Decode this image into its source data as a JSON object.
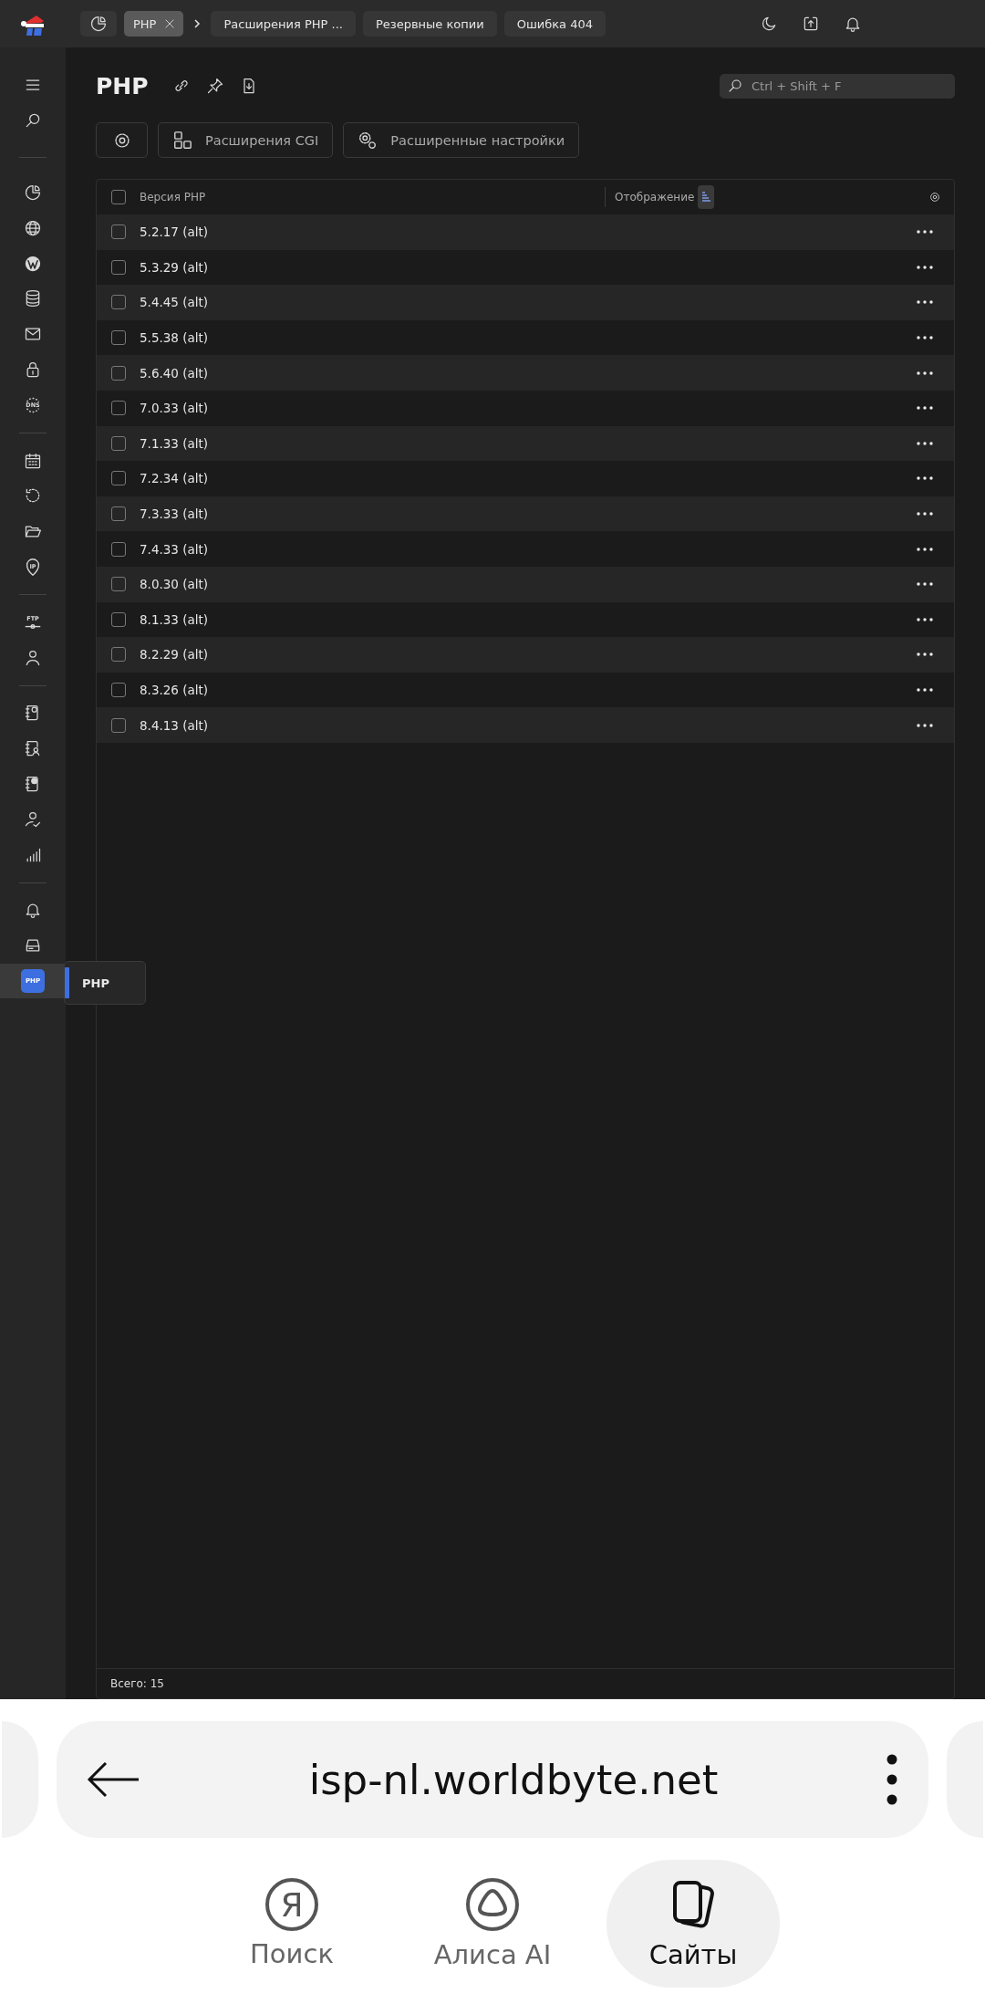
{
  "topbar": {
    "tabs": [
      {
        "kind": "dashboard",
        "selected": false
      },
      {
        "kind": "text",
        "label": "PHP",
        "selected": true,
        "closable": true
      },
      {
        "kind": "text",
        "label": "Расширения PHP ...",
        "selected": false,
        "closable": false
      },
      {
        "kind": "text",
        "label": "Резервные копии",
        "selected": false,
        "closable": false
      },
      {
        "kind": "text",
        "label": "Ошибка 404",
        "selected": false,
        "closable": false
      }
    ],
    "actions": [
      {
        "kind": "moon"
      },
      {
        "kind": "upload"
      },
      {
        "kind": "bell"
      }
    ]
  },
  "sidebar": {
    "groups": [
      [
        {
          "kind": "menu",
          "selected": false
        },
        {
          "kind": "search",
          "selected": false
        }
      ],
      [
        {
          "kind": "pie",
          "selected": false
        },
        {
          "kind": "globe",
          "selected": false
        },
        {
          "kind": "wordpress",
          "selected": false
        },
        {
          "kind": "database",
          "selected": false
        },
        {
          "kind": "mail",
          "selected": false
        },
        {
          "kind": "lock",
          "selected": false
        },
        {
          "kind": "dns",
          "selected": false,
          "text": "DNS"
        }
      ],
      [
        {
          "kind": "calendar",
          "selected": false
        },
        {
          "kind": "history",
          "selected": false
        },
        {
          "kind": "folder",
          "selected": false
        },
        {
          "kind": "ip",
          "selected": false,
          "text": "IP"
        }
      ],
      [
        {
          "kind": "ftp",
          "selected": false,
          "text": "FTP"
        },
        {
          "kind": "user",
          "selected": false
        }
      ],
      [
        {
          "kind": "book-clock",
          "selected": false
        },
        {
          "kind": "book-user",
          "selected": false
        },
        {
          "kind": "book-globe",
          "selected": false
        },
        {
          "kind": "user-check",
          "selected": false
        },
        {
          "kind": "bars",
          "selected": false
        }
      ],
      [
        {
          "kind": "bell",
          "selected": false
        },
        {
          "kind": "drive",
          "selected": false
        },
        {
          "kind": "php",
          "selected": true,
          "text": "PHP"
        }
      ]
    ],
    "tooltip": "PHP"
  },
  "page": {
    "title": "PHP",
    "search": {
      "placeholder": "Ctrl + Shift + F"
    },
    "toolbar": [
      {
        "kind": "gear"
      },
      {
        "kind": "blocks",
        "label": "Расширения CGI"
      },
      {
        "kind": "gears",
        "label": "Расширенные настройки"
      }
    ]
  },
  "table": {
    "select_all": {
      "checked": false
    },
    "columns": [
      "Версия PHP",
      "Отображение"
    ],
    "rows": [
      {
        "version": "5.2.17 (alt)",
        "checked": false
      },
      {
        "version": "5.3.29 (alt)",
        "checked": false
      },
      {
        "version": "5.4.45 (alt)",
        "checked": false
      },
      {
        "version": "5.5.38 (alt)",
        "checked": false
      },
      {
        "version": "5.6.40 (alt)",
        "checked": false
      },
      {
        "version": "7.0.33 (alt)",
        "checked": false
      },
      {
        "version": "7.1.33 (alt)",
        "checked": false
      },
      {
        "version": "7.2.34 (alt)",
        "checked": false
      },
      {
        "version": "7.3.33 (alt)",
        "checked": false
      },
      {
        "version": "7.4.33 (alt)",
        "checked": false
      },
      {
        "version": "8.0.30 (alt)",
        "checked": false
      },
      {
        "version": "8.1.33 (alt)",
        "checked": false
      },
      {
        "version": "8.2.29 (alt)",
        "checked": false
      },
      {
        "version": "8.3.26 (alt)",
        "checked": false
      },
      {
        "version": "8.4.13 (alt)",
        "checked": false
      }
    ],
    "footer": "Всего: 15"
  },
  "browser": {
    "url": "isp-nl.worldbyte.net",
    "nav": [
      {
        "kind": "yandex",
        "icon_text": "Я",
        "label": "Поиск",
        "selected": false
      },
      {
        "kind": "alice",
        "label": "Алиса AI",
        "selected": false
      },
      {
        "kind": "tabs",
        "label": "Сайты",
        "selected": true
      }
    ]
  }
}
